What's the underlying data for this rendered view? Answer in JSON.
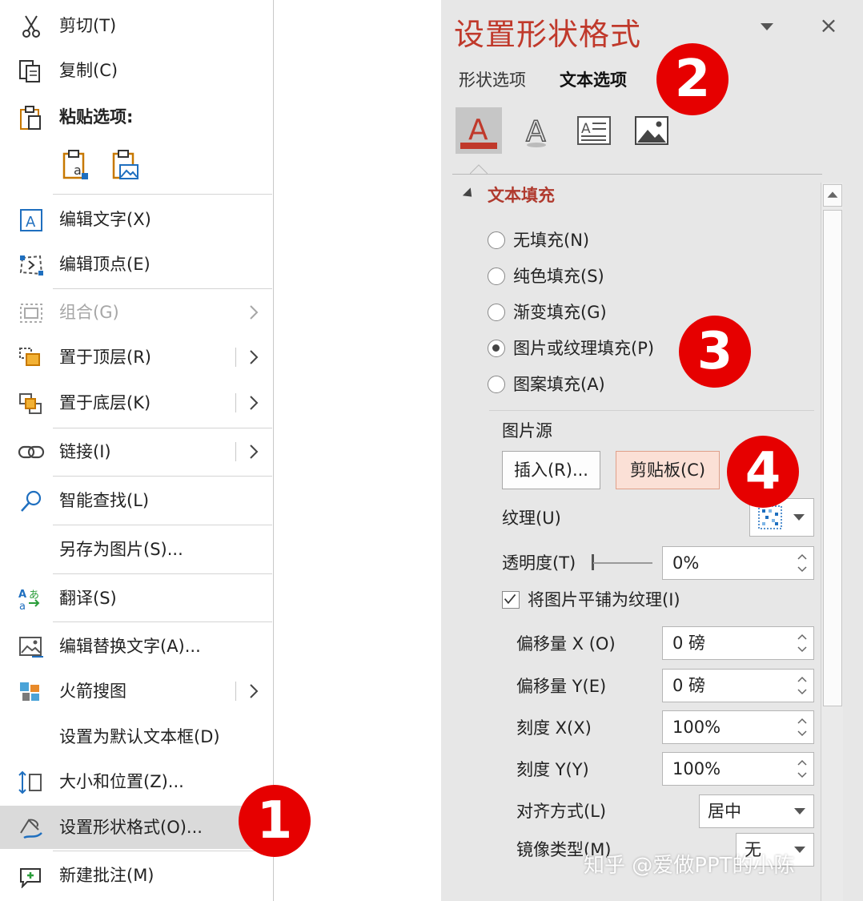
{
  "context_menu": {
    "cut": "剪切(T)",
    "copy": "复制(C)",
    "paste_options": "粘贴选项:",
    "edit_text": "编辑文字(X)",
    "edit_points": "编辑顶点(E)",
    "group": "组合(G)",
    "bring_to_front": "置于顶层(R)",
    "send_to_back": "置于底层(K)",
    "link": "链接(I)",
    "smart_lookup": "智能查找(L)",
    "save_as_picture": "另存为图片(S)...",
    "translate": "翻译(S)",
    "edit_alt_text": "编辑替换文字(A)...",
    "rocket_search": "火箭搜图",
    "set_default_textbox": "设置为默认文本框(D)",
    "size_and_position": "大小和位置(Z)...",
    "format_shape": "设置形状格式(O)...",
    "new_comment": "新建批注(M)"
  },
  "badges": {
    "b1": "1",
    "b2": "2",
    "b3": "3",
    "b4": "4"
  },
  "format_pane": {
    "title": "设置形状格式",
    "close_glyph": "×",
    "tab_shape_options": "形状选项",
    "tab_text_options": "文本选项",
    "section_text_fill": "文本填充",
    "radio_no_fill": "无填充(N)",
    "radio_solid_fill": "纯色填充(S)",
    "radio_gradient_fill": "渐变填充(G)",
    "radio_picture_fill": "图片或纹理填充(P)",
    "radio_pattern_fill": "图案填充(A)",
    "selected_fill": "图片或纹理填充(P)",
    "picture_source": "图片源",
    "insert_button": "插入(R)...",
    "clipboard_button": "剪贴板(C)",
    "texture_label": "纹理(U)",
    "transparency_label": "透明度(T)",
    "transparency_value": "0%",
    "tile_checkbox": "将图片平铺为纹理(I)",
    "tile_checked": true,
    "offset_x_label": "偏移量 X (O)",
    "offset_x_value": "0 磅",
    "offset_y_label": "偏移量 Y(E)",
    "offset_y_value": "0 磅",
    "scale_x_label": "刻度 X(X)",
    "scale_x_value": "100%",
    "scale_y_label": "刻度 Y(Y)",
    "scale_y_value": "100%",
    "alignment_label": "对齐方式(L)",
    "alignment_value": "居中",
    "mirror_label": "镜像类型(M)",
    "mirror_value": "无"
  },
  "watermark": "知乎 @爱做PPT的小陈",
  "colors": {
    "accent": "#c0392b",
    "badge": "#e60000",
    "highlight": "#dadada",
    "pane_bg": "#e7e7e7"
  }
}
